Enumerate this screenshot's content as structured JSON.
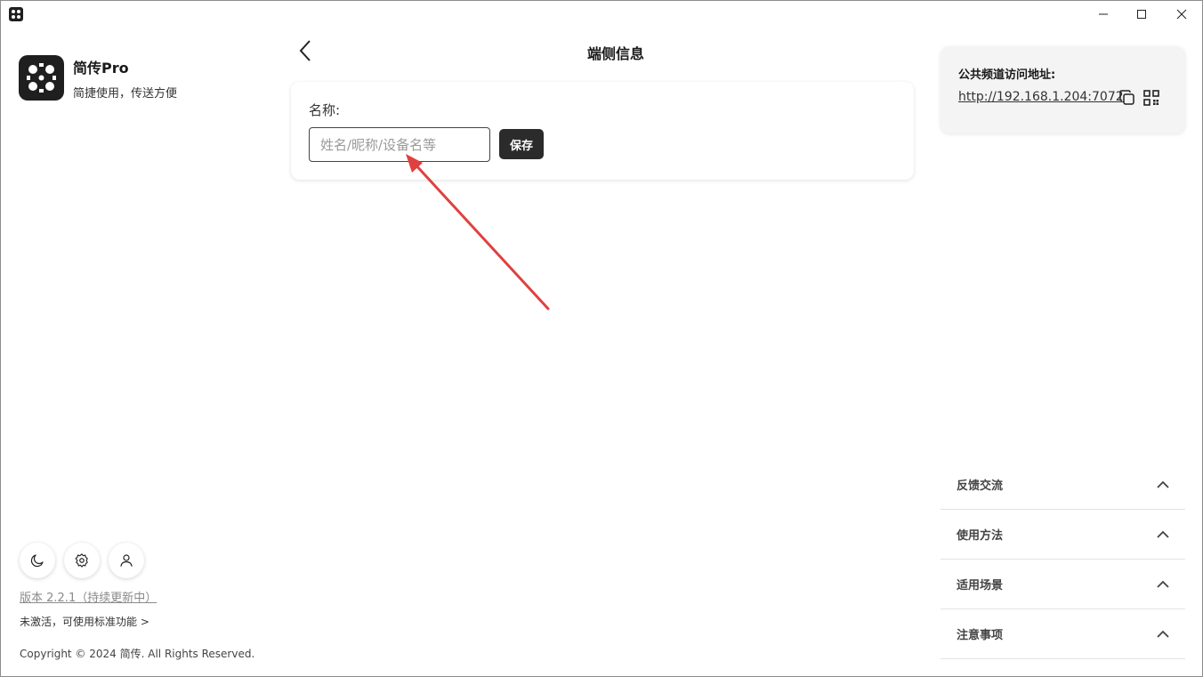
{
  "window": {
    "minimize_label": "minimize",
    "maximize_label": "maximize",
    "close_label": "close"
  },
  "app": {
    "name": "简传Pro",
    "slogan": "简捷使用，传送方便"
  },
  "sidebar": {
    "version": "版本 2.2.1（持续更新中）",
    "activation": "未激活，可使用标准功能 >",
    "copyright": "Copyright © 2024 简传. All Rights Reserved."
  },
  "main": {
    "title": "端侧信息",
    "name_label": "名称:",
    "name_value": "",
    "name_placeholder": "姓名/昵称/设备名等",
    "save_label": "保存"
  },
  "address": {
    "label": "公共频道访问地址:",
    "url": "http://192.168.1.204:7072"
  },
  "accordion": {
    "items": [
      {
        "label": "反馈交流"
      },
      {
        "label": "使用方法"
      },
      {
        "label": "适用场景"
      },
      {
        "label": "注意事项"
      }
    ]
  },
  "colors": {
    "accent_dark": "#2b2b2b",
    "annotation_red": "#e04040",
    "panel_bg": "#f4f4f4"
  },
  "icons": {
    "back": "chevron-left-icon",
    "theme": "moon-icon",
    "settings": "gear-icon",
    "user": "user-icon",
    "copy": "copy-icon",
    "qr": "qr-code-icon",
    "expand": "chevron-up-icon"
  }
}
